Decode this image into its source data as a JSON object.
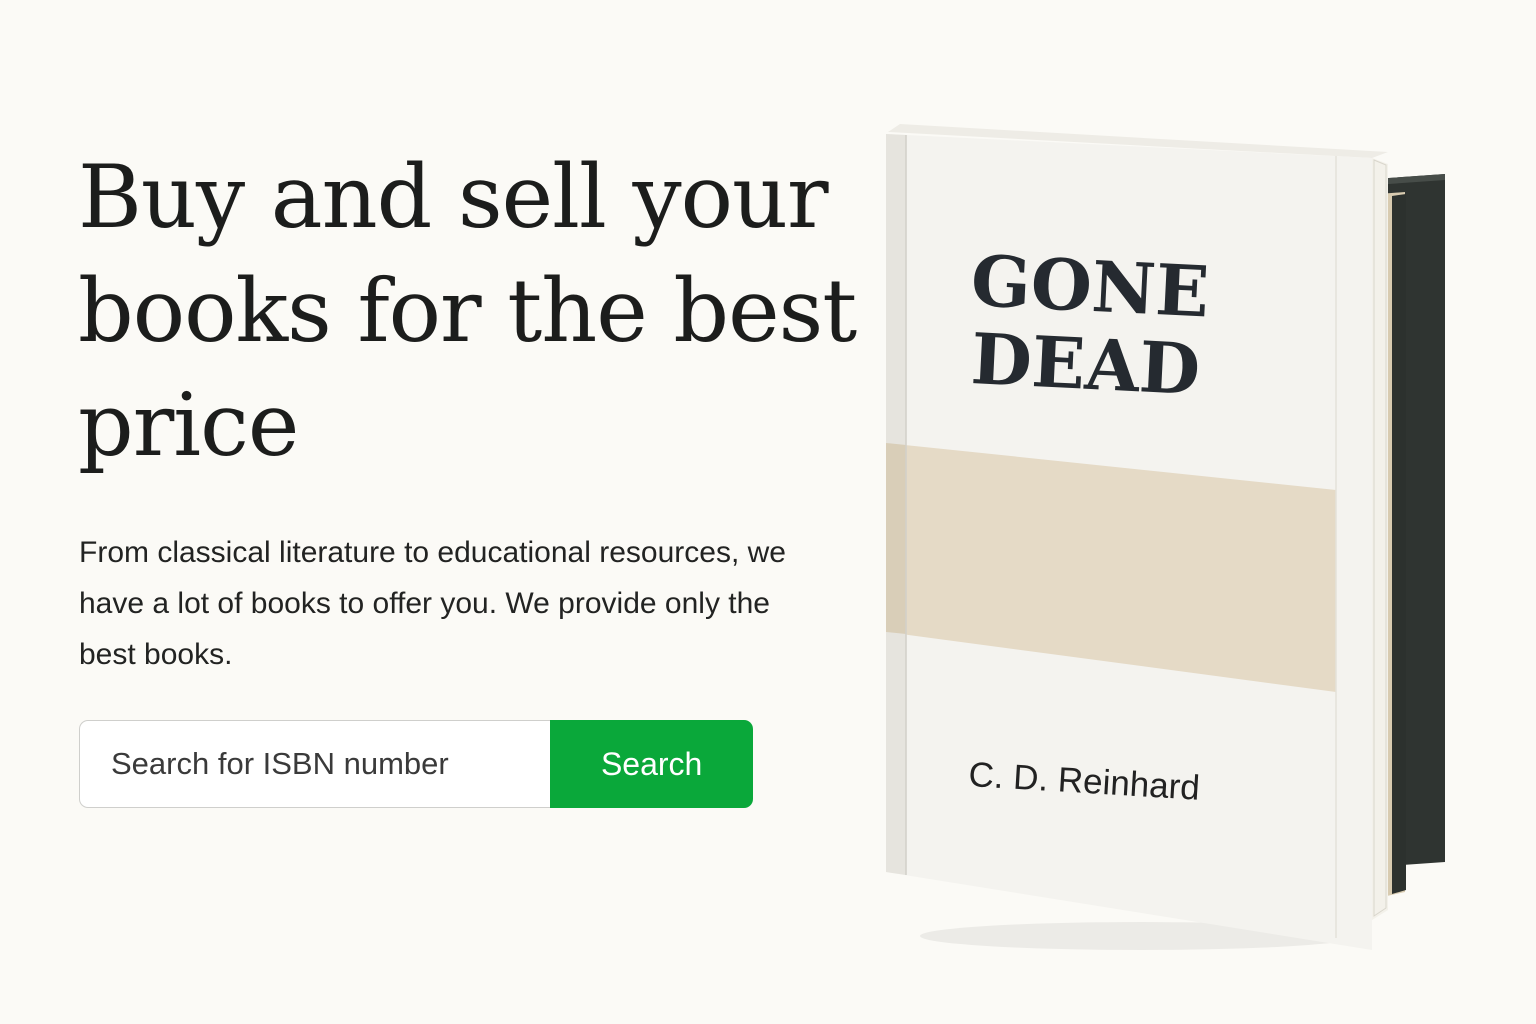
{
  "hero": {
    "headline": "Buy and sell your books for the best price",
    "subtext": "From classical literature to educational resources, we have a lot of books to offer you. We provide only the best books."
  },
  "search": {
    "placeholder": "Search for ISBN number",
    "button_label": "Search"
  },
  "book": {
    "title_line1": "GONE",
    "title_line2": "DEAD",
    "author": "C. D. Reinhard"
  },
  "colors": {
    "background": "#fbfaf6",
    "accent_green": "#0aa83a",
    "band_beige": "#e5dac6",
    "title_ink": "#252a30"
  }
}
